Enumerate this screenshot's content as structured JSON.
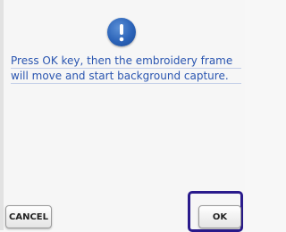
{
  "dialog": {
    "icon": "exclamation-icon",
    "message_lines": [
      "Press OK key, then the embroidery frame",
      "will move and start background capture."
    ],
    "cancel_label": "CANCEL",
    "ok_label": "OK",
    "accent_color": "#2a55b0",
    "focus_color": "#2a1b8c"
  }
}
